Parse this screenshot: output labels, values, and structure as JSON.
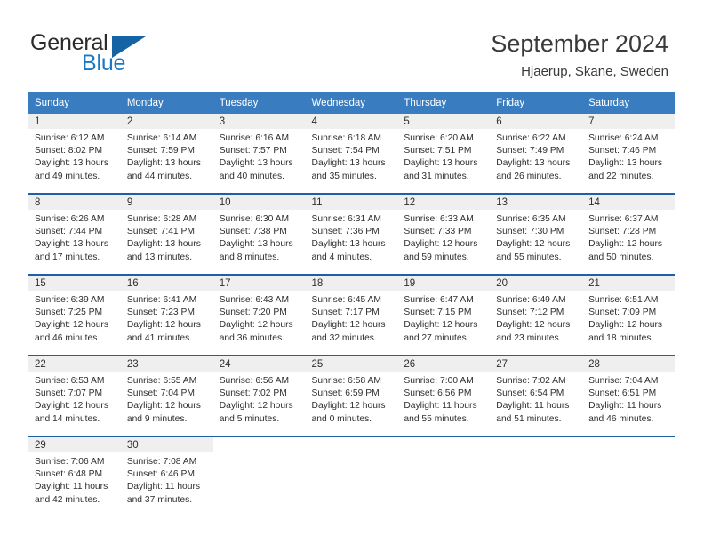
{
  "brand": {
    "word_one": "General",
    "word_two": "Blue",
    "triangle_icon": "triangle-logo-icon",
    "colors": {
      "blue": "#1b79c4",
      "dark_blue": "#1464a5",
      "text": "#2b2b2b"
    }
  },
  "header": {
    "title": "September 2024",
    "location": "Hjaerup, Skane, Sweden"
  },
  "theme": {
    "header_row_bg": "#3a7cc0",
    "header_row_text": "#ffffff",
    "daynum_bg": "#efefef",
    "separator": "#1f5fa8",
    "body_text": "#2e2e2e"
  },
  "labels": {
    "sunrise": "Sunrise:",
    "sunset": "Sunset:",
    "daylight": "Daylight:"
  },
  "weekdays": [
    "Sunday",
    "Monday",
    "Tuesday",
    "Wednesday",
    "Thursday",
    "Friday",
    "Saturday"
  ],
  "weeks": [
    [
      {
        "day": "1",
        "sunrise": "Sunrise: 6:12 AM",
        "sunset": "Sunset: 8:02 PM",
        "daylight_line1": "Daylight: 13 hours",
        "daylight_line2": "and 49 minutes."
      },
      {
        "day": "2",
        "sunrise": "Sunrise: 6:14 AM",
        "sunset": "Sunset: 7:59 PM",
        "daylight_line1": "Daylight: 13 hours",
        "daylight_line2": "and 44 minutes."
      },
      {
        "day": "3",
        "sunrise": "Sunrise: 6:16 AM",
        "sunset": "Sunset: 7:57 PM",
        "daylight_line1": "Daylight: 13 hours",
        "daylight_line2": "and 40 minutes."
      },
      {
        "day": "4",
        "sunrise": "Sunrise: 6:18 AM",
        "sunset": "Sunset: 7:54 PM",
        "daylight_line1": "Daylight: 13 hours",
        "daylight_line2": "and 35 minutes."
      },
      {
        "day": "5",
        "sunrise": "Sunrise: 6:20 AM",
        "sunset": "Sunset: 7:51 PM",
        "daylight_line1": "Daylight: 13 hours",
        "daylight_line2": "and 31 minutes."
      },
      {
        "day": "6",
        "sunrise": "Sunrise: 6:22 AM",
        "sunset": "Sunset: 7:49 PM",
        "daylight_line1": "Daylight: 13 hours",
        "daylight_line2": "and 26 minutes."
      },
      {
        "day": "7",
        "sunrise": "Sunrise: 6:24 AM",
        "sunset": "Sunset: 7:46 PM",
        "daylight_line1": "Daylight: 13 hours",
        "daylight_line2": "and 22 minutes."
      }
    ],
    [
      {
        "day": "8",
        "sunrise": "Sunrise: 6:26 AM",
        "sunset": "Sunset: 7:44 PM",
        "daylight_line1": "Daylight: 13 hours",
        "daylight_line2": "and 17 minutes."
      },
      {
        "day": "9",
        "sunrise": "Sunrise: 6:28 AM",
        "sunset": "Sunset: 7:41 PM",
        "daylight_line1": "Daylight: 13 hours",
        "daylight_line2": "and 13 minutes."
      },
      {
        "day": "10",
        "sunrise": "Sunrise: 6:30 AM",
        "sunset": "Sunset: 7:38 PM",
        "daylight_line1": "Daylight: 13 hours",
        "daylight_line2": "and 8 minutes."
      },
      {
        "day": "11",
        "sunrise": "Sunrise: 6:31 AM",
        "sunset": "Sunset: 7:36 PM",
        "daylight_line1": "Daylight: 13 hours",
        "daylight_line2": "and 4 minutes."
      },
      {
        "day": "12",
        "sunrise": "Sunrise: 6:33 AM",
        "sunset": "Sunset: 7:33 PM",
        "daylight_line1": "Daylight: 12 hours",
        "daylight_line2": "and 59 minutes."
      },
      {
        "day": "13",
        "sunrise": "Sunrise: 6:35 AM",
        "sunset": "Sunset: 7:30 PM",
        "daylight_line1": "Daylight: 12 hours",
        "daylight_line2": "and 55 minutes."
      },
      {
        "day": "14",
        "sunrise": "Sunrise: 6:37 AM",
        "sunset": "Sunset: 7:28 PM",
        "daylight_line1": "Daylight: 12 hours",
        "daylight_line2": "and 50 minutes."
      }
    ],
    [
      {
        "day": "15",
        "sunrise": "Sunrise: 6:39 AM",
        "sunset": "Sunset: 7:25 PM",
        "daylight_line1": "Daylight: 12 hours",
        "daylight_line2": "and 46 minutes."
      },
      {
        "day": "16",
        "sunrise": "Sunrise: 6:41 AM",
        "sunset": "Sunset: 7:23 PM",
        "daylight_line1": "Daylight: 12 hours",
        "daylight_line2": "and 41 minutes."
      },
      {
        "day": "17",
        "sunrise": "Sunrise: 6:43 AM",
        "sunset": "Sunset: 7:20 PM",
        "daylight_line1": "Daylight: 12 hours",
        "daylight_line2": "and 36 minutes."
      },
      {
        "day": "18",
        "sunrise": "Sunrise: 6:45 AM",
        "sunset": "Sunset: 7:17 PM",
        "daylight_line1": "Daylight: 12 hours",
        "daylight_line2": "and 32 minutes."
      },
      {
        "day": "19",
        "sunrise": "Sunrise: 6:47 AM",
        "sunset": "Sunset: 7:15 PM",
        "daylight_line1": "Daylight: 12 hours",
        "daylight_line2": "and 27 minutes."
      },
      {
        "day": "20",
        "sunrise": "Sunrise: 6:49 AM",
        "sunset": "Sunset: 7:12 PM",
        "daylight_line1": "Daylight: 12 hours",
        "daylight_line2": "and 23 minutes."
      },
      {
        "day": "21",
        "sunrise": "Sunrise: 6:51 AM",
        "sunset": "Sunset: 7:09 PM",
        "daylight_line1": "Daylight: 12 hours",
        "daylight_line2": "and 18 minutes."
      }
    ],
    [
      {
        "day": "22",
        "sunrise": "Sunrise: 6:53 AM",
        "sunset": "Sunset: 7:07 PM",
        "daylight_line1": "Daylight: 12 hours",
        "daylight_line2": "and 14 minutes."
      },
      {
        "day": "23",
        "sunrise": "Sunrise: 6:55 AM",
        "sunset": "Sunset: 7:04 PM",
        "daylight_line1": "Daylight: 12 hours",
        "daylight_line2": "and 9 minutes."
      },
      {
        "day": "24",
        "sunrise": "Sunrise: 6:56 AM",
        "sunset": "Sunset: 7:02 PM",
        "daylight_line1": "Daylight: 12 hours",
        "daylight_line2": "and 5 minutes."
      },
      {
        "day": "25",
        "sunrise": "Sunrise: 6:58 AM",
        "sunset": "Sunset: 6:59 PM",
        "daylight_line1": "Daylight: 12 hours",
        "daylight_line2": "and 0 minutes."
      },
      {
        "day": "26",
        "sunrise": "Sunrise: 7:00 AM",
        "sunset": "Sunset: 6:56 PM",
        "daylight_line1": "Daylight: 11 hours",
        "daylight_line2": "and 55 minutes."
      },
      {
        "day": "27",
        "sunrise": "Sunrise: 7:02 AM",
        "sunset": "Sunset: 6:54 PM",
        "daylight_line1": "Daylight: 11 hours",
        "daylight_line2": "and 51 minutes."
      },
      {
        "day": "28",
        "sunrise": "Sunrise: 7:04 AM",
        "sunset": "Sunset: 6:51 PM",
        "daylight_line1": "Daylight: 11 hours",
        "daylight_line2": "and 46 minutes."
      }
    ],
    [
      {
        "day": "29",
        "sunrise": "Sunrise: 7:06 AM",
        "sunset": "Sunset: 6:48 PM",
        "daylight_line1": "Daylight: 11 hours",
        "daylight_line2": "and 42 minutes."
      },
      {
        "day": "30",
        "sunrise": "Sunrise: 7:08 AM",
        "sunset": "Sunset: 6:46 PM",
        "daylight_line1": "Daylight: 11 hours",
        "daylight_line2": "and 37 minutes."
      },
      {
        "day": "",
        "sunrise": "",
        "sunset": "",
        "daylight_line1": "",
        "daylight_line2": ""
      },
      {
        "day": "",
        "sunrise": "",
        "sunset": "",
        "daylight_line1": "",
        "daylight_line2": ""
      },
      {
        "day": "",
        "sunrise": "",
        "sunset": "",
        "daylight_line1": "",
        "daylight_line2": ""
      },
      {
        "day": "",
        "sunrise": "",
        "sunset": "",
        "daylight_line1": "",
        "daylight_line2": ""
      },
      {
        "day": "",
        "sunrise": "",
        "sunset": "",
        "daylight_line1": "",
        "daylight_line2": ""
      }
    ]
  ]
}
